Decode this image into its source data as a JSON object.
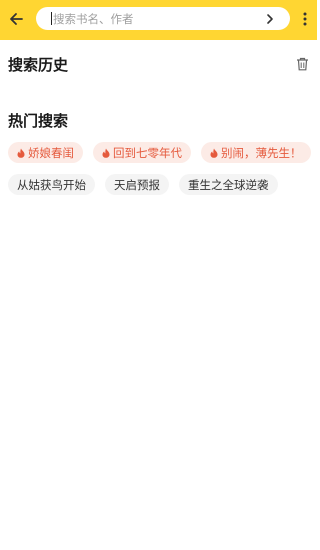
{
  "colors": {
    "accent": "#ffd632",
    "hot_text": "#e55a3d",
    "hot_bg": "#fcebe6",
    "plain_bg": "#f4f4f4"
  },
  "topbar": {
    "back_icon": "arrow-left-icon",
    "search_placeholder": "搜索书名、作者",
    "go_icon": "chevron-right-icon",
    "more_icon": "more-vertical-icon"
  },
  "history": {
    "title": "搜索历史",
    "delete_icon": "trash-icon"
  },
  "hot": {
    "title": "热门搜索",
    "hot_tags": [
      {
        "label": "娇娘春闺",
        "icon": "flame-icon"
      },
      {
        "label": "回到七零年代",
        "icon": "flame-icon"
      },
      {
        "label": "别闹，薄先生！",
        "icon": "flame-icon"
      }
    ],
    "tags": [
      {
        "label": "从姑获鸟开始"
      },
      {
        "label": "天启预报"
      },
      {
        "label": "重生之全球逆袭"
      }
    ]
  }
}
